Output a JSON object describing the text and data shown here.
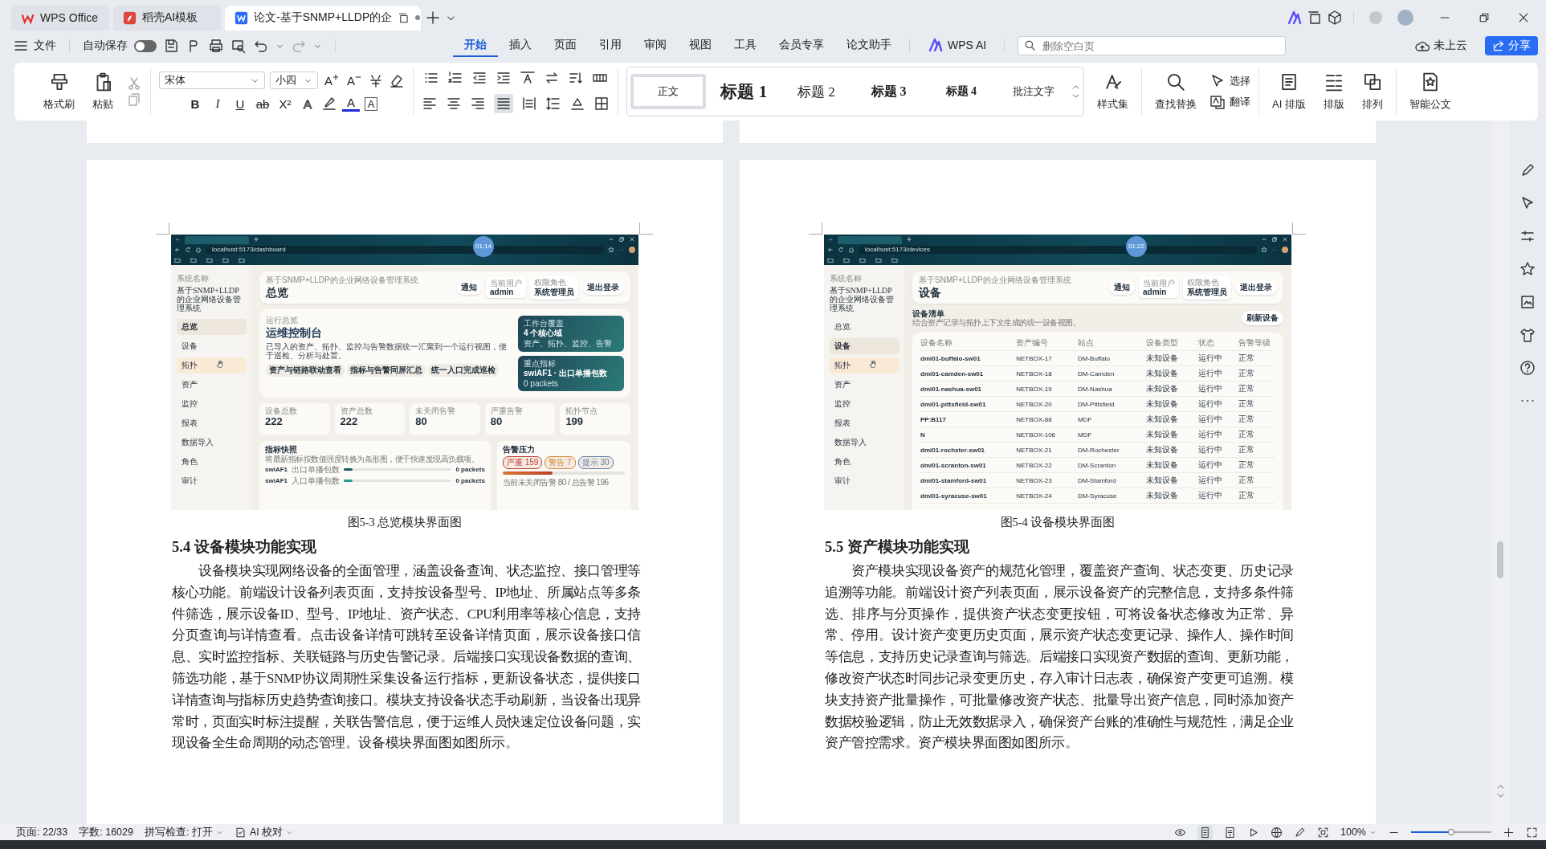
{
  "app_tabs": [
    {
      "label": "WPS Office",
      "kind": "wps",
      "selected": false
    },
    {
      "label": "稻壳AI模板",
      "kind": "docer",
      "selected": false
    },
    {
      "label": "论文-基于SNMP+LLDP的企",
      "kind": "doc",
      "selected": true
    }
  ],
  "quick_bar": {
    "file_menu": "文件",
    "autosave": {
      "label": "自动保存",
      "on": false
    }
  },
  "ribbon_tabs": [
    {
      "label": "开始",
      "selected": true
    },
    {
      "label": "插入",
      "selected": false
    },
    {
      "label": "页面",
      "selected": false
    },
    {
      "label": "引用",
      "selected": false
    },
    {
      "label": "审阅",
      "selected": false
    },
    {
      "label": "视图",
      "selected": false
    },
    {
      "label": "工具",
      "selected": false
    },
    {
      "label": "会员专享",
      "selected": false
    },
    {
      "label": "论文助手",
      "selected": false
    }
  ],
  "ai_button": "WPS AI",
  "search": {
    "placeholder": "删除空白页"
  },
  "cloud_status": "未上云",
  "share_button": "分享",
  "ribbon": {
    "format_painter": "格式刷",
    "paste": "粘贴",
    "font": {
      "family": "宋体",
      "size": "小四",
      "grow": "A",
      "shrink": "A",
      "format_buttons": [
        {
          "glyph": "B",
          "kind": "bold"
        },
        {
          "glyph": "I",
          "kind": "italic"
        },
        {
          "glyph": "U",
          "kind": "underline"
        },
        {
          "glyph": "ab",
          "kind": "strike"
        },
        {
          "glyph": "X²",
          "kind": "superscript"
        },
        {
          "glyph": "A",
          "kind": "effect"
        },
        {
          "glyph": "A",
          "kind": "color"
        },
        {
          "glyph": "A",
          "kind": "border"
        }
      ]
    },
    "styles": [
      {
        "label": "正文",
        "kind": "body",
        "selected": true
      },
      {
        "label": "标题 1",
        "kind": "h1",
        "selected": false
      },
      {
        "label": "标题 2",
        "kind": "h2",
        "selected": false
      },
      {
        "label": "标题 3",
        "kind": "h3",
        "selected": false
      },
      {
        "label": "标题 4",
        "kind": "h4",
        "selected": false
      },
      {
        "label": "批注文字",
        "kind": "note",
        "selected": false
      }
    ],
    "style_set": "样式集",
    "find_replace": "查找替换",
    "select": "选择",
    "translate": "翻译",
    "ai_layout": "AI 排版",
    "layout": "排版",
    "arrange": "排列",
    "smart_doc": "智能公文"
  },
  "pages": [
    {
      "screenshot": {
        "kind": "dashboard",
        "clock": "01:14",
        "url": "localhost:5173/dashboard",
        "sidebar": {
          "label": "系统名称",
          "name": "基于SNMP+LLDP的企业网络设备管理系统",
          "nav": [
            {
              "label": "总览",
              "selected": true,
              "hovered": false
            },
            {
              "label": "设备",
              "selected": false,
              "hovered": false
            },
            {
              "label": "拓扑",
              "selected": false,
              "hovered": true
            },
            {
              "label": "资产",
              "selected": false,
              "hovered": false
            },
            {
              "label": "监控",
              "selected": false,
              "hovered": false
            },
            {
              "label": "报表",
              "selected": false,
              "hovered": false
            },
            {
              "label": "数据导入",
              "selected": false,
              "hovered": false
            },
            {
              "label": "角色",
              "selected": false,
              "hovered": false
            },
            {
              "label": "审计",
              "selected": false,
              "hovered": false
            }
          ]
        },
        "header": {
          "subtitle": "基于SNMP+LLDP的企业网络设备管理系统",
          "title": "总览",
          "notify": "通知",
          "user_label": "当前用户",
          "user": "admin",
          "role_label": "权限角色",
          "role": "系统管理员",
          "logout": "退出登录"
        },
        "hero": {
          "eyebrow": "运行总览",
          "title": "运维控制台",
          "description": "已导入的资产、拓扑、监控与告警数据统一汇聚到一个运行视图，便于巡检、分析与处置。",
          "chips": [
            "资产与链路联动查看",
            "指标与告警同屏汇总",
            "统一入口完成巡检"
          ],
          "cards": [
            {
              "label": "工作台覆盖",
              "value": "4 个核心域",
              "note": "资产、拓扑、监控、告警"
            },
            {
              "label": "重点指标",
              "value": "swiAF1 · 出口单播包数",
              "note": "0 packets"
            }
          ]
        },
        "stats": [
          {
            "label": "设备总数",
            "value": "222"
          },
          {
            "label": "资产总数",
            "value": "222"
          },
          {
            "label": "未关闭告警",
            "value": "80"
          },
          {
            "label": "严重告警",
            "value": "80"
          },
          {
            "label": "拓扑节点",
            "value": "199"
          }
        ],
        "metrics": {
          "title": "指标快照",
          "description": "将最新指标按数值强度转换为条形图，便于快速发现高负载项。",
          "rows": [
            {
              "name": "swiAF1",
              "metric": "出口单播包数",
              "level": 0.08,
              "reading": "0 packets",
              "color": "#1f5a66"
            },
            {
              "name": "swiAF1",
              "metric": "入口单播包数",
              "level": 0.08,
              "reading": "0 packets",
              "color": "#2a9d8f"
            }
          ]
        },
        "alerts": {
          "title": "告警压力",
          "tags": [
            {
              "label": "严重 159",
              "color": "#c0392b"
            },
            {
              "label": "警告 7",
              "color": "#d4872c"
            },
            {
              "label": "提示 30",
              "color": "#5b7fa8"
            }
          ],
          "level": 0.41,
          "summary": "当前未关闭告警 80 / 总告警 196"
        }
      },
      "caption": "图5-3 总览模块界面图",
      "heading": "5.4 设备模块功能实现",
      "paragraph": "设备模块实现网络设备的全面管理，涵盖设备查询、状态监控、接口管理等核心功能。前端设计设备列表页面，支持按设备型号、IP地址、所属站点等多条件筛选，展示设备ID、型号、IP地址、资产状态、CPU利用率等核心信息，支持分页查询与详情查看。点击设备详情可跳转至设备详情页面，展示设备接口信息、实时监控指标、关联链路与历史告警记录。后端接口实现设备数据的查询、筛选功能，基于SNMP协议周期性采集设备运行指标，更新设备状态，提供接口详情查询与指标历史趋势查询接口。模块支持设备状态手动刷新，当设备出现异常时，页面实时标注提醒，关联告警信息，便于运维人员快速定位设备问题，实现设备全生命周期的动态管理。设备模块界面图如图所示。"
    },
    {
      "screenshot": {
        "kind": "devices",
        "clock": "01:22",
        "url": "localhost:5173/devices",
        "sidebar": {
          "label": "系统名称",
          "name": "基于SNMP+LLDP的企业网络设备管理系统",
          "nav": [
            {
              "label": "总览",
              "selected": false,
              "hovered": false
            },
            {
              "label": "设备",
              "selected": true,
              "hovered": false
            },
            {
              "label": "拓扑",
              "selected": false,
              "hovered": true
            },
            {
              "label": "资产",
              "selected": false,
              "hovered": false
            },
            {
              "label": "监控",
              "selected": false,
              "hovered": false
            },
            {
              "label": "报表",
              "selected": false,
              "hovered": false
            },
            {
              "label": "数据导入",
              "selected": false,
              "hovered": false
            },
            {
              "label": "角色",
              "selected": false,
              "hovered": false
            },
            {
              "label": "审计",
              "selected": false,
              "hovered": false
            }
          ]
        },
        "header": {
          "subtitle": "基于SNMP+LLDP的企业网络设备管理系统",
          "title": "设备",
          "notify": "通知",
          "user_label": "当前用户",
          "user": "admin",
          "role_label": "权限角色",
          "role": "系统管理员",
          "logout": "退出登录"
        },
        "list": {
          "title": "设备清单",
          "description": "结合资产记录与拓扑上下文生成的统一设备视图。",
          "refresh": "刷新设备"
        },
        "table": {
          "columns": [
            "设备名称",
            "资产编号",
            "站点",
            "设备类型",
            "状态",
            "告警等级"
          ],
          "rows": [
            [
              "dmi01-buffalo-sw01",
              "NETBOX-17",
              "DM-Buffalo",
              "未知设备",
              "运行中",
              "正常"
            ],
            [
              "dmi01-camden-sw01",
              "NETBOX-18",
              "DM-Camden",
              "未知设备",
              "运行中",
              "正常"
            ],
            [
              "dmi01-nashua-sw01",
              "NETBOX-19",
              "DM-Nashua",
              "未知设备",
              "运行中",
              "正常"
            ],
            [
              "dmi01-pittsfield-sw01",
              "NETBOX-20",
              "DM-Pittsfield",
              "未知设备",
              "运行中",
              "正常"
            ],
            [
              "PP:B117",
              "NETBOX-88",
              "MDF",
              "未知设备",
              "运行中",
              "正常"
            ],
            [
              "N",
              "NETBOX-106",
              "MDF",
              "未知设备",
              "运行中",
              "正常"
            ],
            [
              "dmi01-rochster-sw01",
              "NETBOX-21",
              "DM-Rochester",
              "未知设备",
              "运行中",
              "正常"
            ],
            [
              "dmi01-scranton-sw01",
              "NETBOX-22",
              "DM-Scranton",
              "未知设备",
              "运行中",
              "正常"
            ],
            [
              "dmi01-stamford-sw01",
              "NETBOX-23",
              "DM-Stamford",
              "未知设备",
              "运行中",
              "正常"
            ],
            [
              "dmi01-syracuse-sw01",
              "NETBOX-24",
              "DM-Syracuse",
              "未知设备",
              "运行中",
              "正常"
            ]
          ]
        }
      },
      "caption": "图5-4 设备模块界面图",
      "heading": "5.5 资产模块功能实现",
      "paragraph": "资产模块实现设备资产的规范化管理，覆盖资产查询、状态变更、历史记录追溯等功能。前端设计资产列表页面，展示设备资产的完整信息，支持多条件筛选、排序与分页操作，提供资产状态变更按钮，可将设备状态修改为正常、异常、停用。设计资产变更历史页面，展示资产状态变更记录、操作人、操作时间等信息，支持历史记录查询与筛选。后端接口实现资产数据的查询、更新功能，修改资产状态时同步记录变更历史，存入审计日志表，确保资产变更可追溯。模块支持资产批量操作，可批量修改资产状态、批量导出资产信息，同时添加资产数据校验逻辑，防止无效数据录入，确保资产台账的准确性与规范性，满足企业资产管控需求。资产模块界面图如图所示。"
    }
  ],
  "status_bar": {
    "page": "页面: 22/33",
    "words": "字数: 16029",
    "spell_check": "拼写检查: 打开",
    "ai_proofread": "AI 校对",
    "zoom": "100%",
    "zoom_slider": {
      "level": 0.5
    }
  }
}
